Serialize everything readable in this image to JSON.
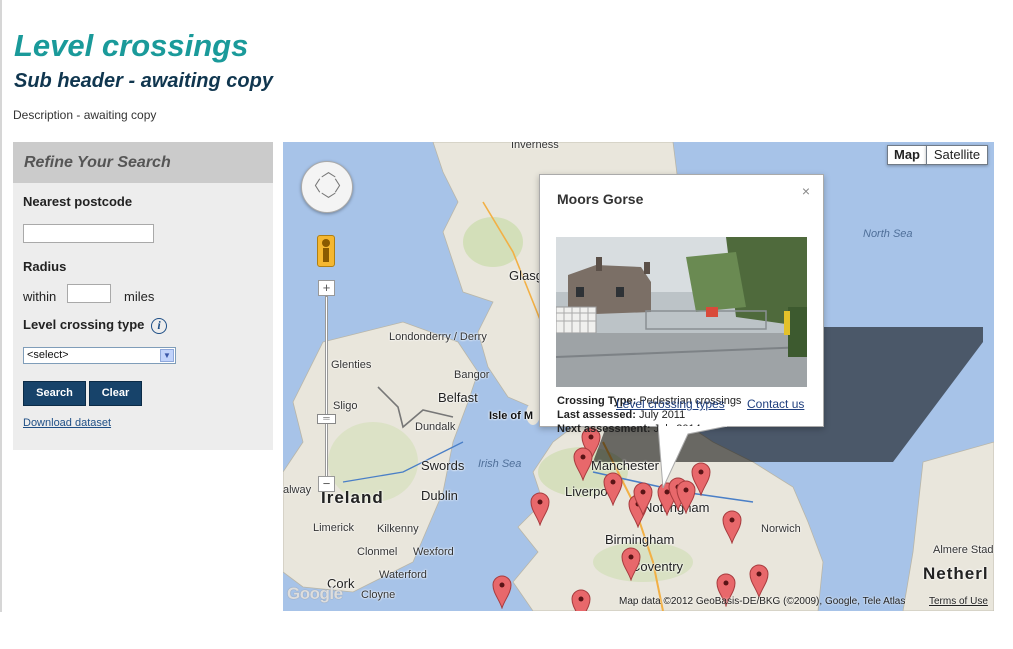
{
  "header": {
    "title": "Level crossings",
    "subtitle": "Sub header - awaiting copy",
    "description": "Description - awaiting copy"
  },
  "refine": {
    "heading": "Refine Your Search",
    "postcode_label": "Nearest postcode",
    "postcode_value": "",
    "radius_label": "Radius",
    "within_label": "within",
    "radius_value": "",
    "miles_label": "miles",
    "type_label": "Level crossing type",
    "info_icon": "i",
    "type_selected": "<select>",
    "search_label": "Search",
    "clear_label": "Clear",
    "download_label": "Download dataset"
  },
  "map": {
    "map_button": "Map",
    "satellite_button": "Satellite",
    "zoom_in": "+",
    "zoom_out": "−",
    "google": "Google",
    "copyright": "Map data ©2012 GeoBasis-DE/BKG (©2009), Google, Tele Atlas",
    "terms": "Terms of Use",
    "places": {
      "inverness": "Inverness",
      "north_sea": "North Sea",
      "glasgow": "Glasg",
      "londonderry": "Londonderry / Derry",
      "glenties": "Glenties",
      "bangor": "Bangor",
      "belfast": "Belfast",
      "sligo": "Sligo",
      "isle_of_man": "Isle of M",
      "dundalk": "Dundalk",
      "swords": "Swords",
      "irish_sea": "Irish Sea",
      "manchester": "Manchester",
      "galway": "alway",
      "ireland": "Ireland",
      "dublin": "Dublin",
      "liverpool": "Liverpo",
      "nottingham": "Nottingham",
      "limerick": "Limerick",
      "kilkenny": "Kilkenny",
      "norwich": "Norwich",
      "birmingham": "Birmingham",
      "clonmel": "Clonmel",
      "wexford": "Wexford",
      "coventry": "Coventry",
      "almere": "Almere Stad",
      "waterford": "Waterford",
      "cork": "Cork",
      "cloyne": "Cloyne",
      "netherlands": "Netherl"
    },
    "info_window": {
      "title": "Moors Gorse",
      "close": "×",
      "type_label": "Crossing Type:",
      "type_value": "Pedestrian crossings",
      "last_label": "Last assessed:",
      "last_value": "July 2011",
      "next_label": "Next assessment:",
      "next_value": "July 2014",
      "link_types": "Level crossing types",
      "link_contact": "Contact us"
    }
  },
  "colors": {
    "title": "#1a9a9a",
    "subtitle": "#10364f",
    "button": "#17436a",
    "marker": "#e8686b",
    "sea": "#a7c3e8",
    "land": "#e9e6dc"
  }
}
